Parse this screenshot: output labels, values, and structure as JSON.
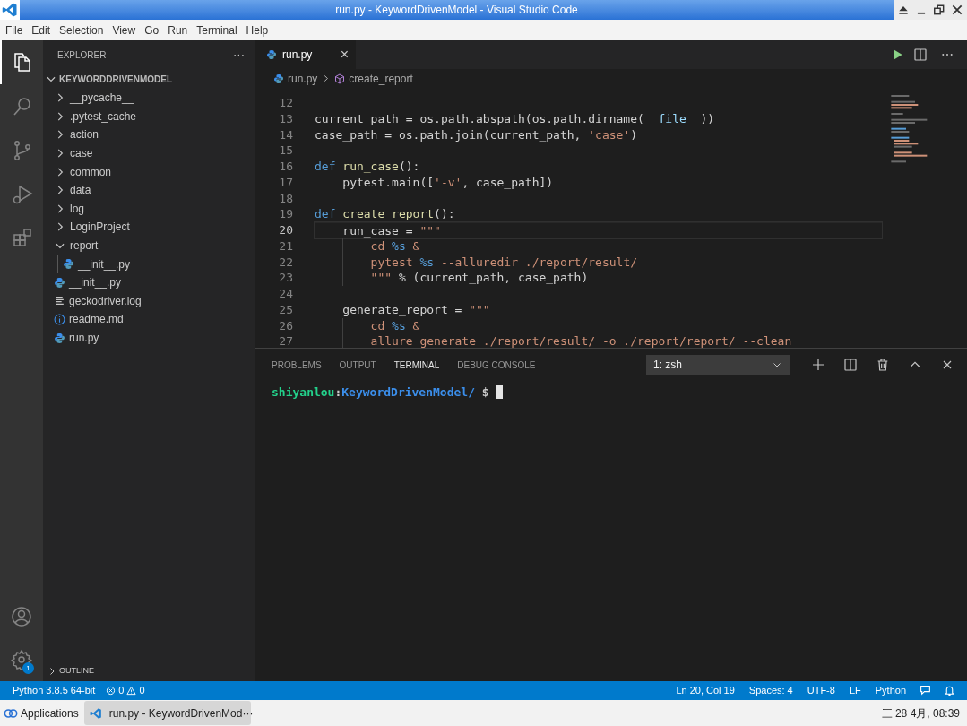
{
  "window": {
    "title": "run.py - KeywordDrivenModel - Visual Studio Code"
  },
  "menu": [
    "File",
    "Edit",
    "Selection",
    "View",
    "Go",
    "Run",
    "Terminal",
    "Help"
  ],
  "activity_bar": [
    {
      "kind": "files",
      "selected": true
    },
    {
      "kind": "search",
      "selected": false
    },
    {
      "kind": "scm",
      "selected": false
    },
    {
      "kind": "debug",
      "selected": false
    },
    {
      "kind": "extensions",
      "selected": false
    }
  ],
  "activity_bottom": [
    {
      "kind": "account"
    },
    {
      "kind": "settings",
      "badge": "1"
    }
  ],
  "sidebar": {
    "title": "EXPLORER",
    "more": "···",
    "root": {
      "label": "KEYWORDDRIVENMODEL",
      "expanded": true
    },
    "items": [
      {
        "kind": "folder",
        "label": "__pycache__",
        "expanded": false
      },
      {
        "kind": "folder",
        "label": ".pytest_cache",
        "expanded": false
      },
      {
        "kind": "folder",
        "label": "action",
        "expanded": false
      },
      {
        "kind": "folder",
        "label": "case",
        "expanded": false
      },
      {
        "kind": "folder",
        "label": "common",
        "expanded": false
      },
      {
        "kind": "folder",
        "label": "data",
        "expanded": false
      },
      {
        "kind": "folder",
        "label": "log",
        "expanded": false
      },
      {
        "kind": "folder",
        "label": "LoginProject",
        "expanded": false
      },
      {
        "kind": "folder",
        "label": "report",
        "expanded": true,
        "children": [
          {
            "kind": "python",
            "label": "__init__.py"
          }
        ]
      },
      {
        "kind": "python",
        "label": "__init__.py"
      },
      {
        "kind": "log",
        "label": "geckodriver.log"
      },
      {
        "kind": "info",
        "label": "readme.md"
      },
      {
        "kind": "python",
        "label": "run.py"
      }
    ],
    "outline": {
      "label": "OUTLINE",
      "expanded": false
    }
  },
  "tabs": [
    {
      "label": "run.py",
      "selected": true,
      "close": "×"
    }
  ],
  "breadcrumb": [
    {
      "kind": "python",
      "label": "run.py"
    },
    {
      "kind": "method",
      "label": "create_report"
    }
  ],
  "code": [
    {
      "number": "12",
      "current": false
    },
    {
      "number": "13",
      "current": false,
      "tokens": [
        {
          "kind": "plain",
          "text": "current_path = os.path.abspath(os.path.dirname("
        },
        {
          "kind": "variable",
          "text": "__file__"
        },
        {
          "kind": "plain",
          "text": "))"
        }
      ]
    },
    {
      "number": "14",
      "current": false,
      "tokens": [
        {
          "kind": "plain",
          "text": "case_path = os.path.join(current_path, "
        },
        {
          "kind": "string",
          "text": "'case'"
        },
        {
          "kind": "plain",
          "text": ")"
        }
      ]
    },
    {
      "number": "15",
      "current": false
    },
    {
      "number": "16",
      "current": false,
      "tokens": [
        {
          "kind": "keyword",
          "text": "def "
        },
        {
          "kind": "function",
          "text": "run_case"
        },
        {
          "kind": "plain",
          "text": "():"
        }
      ]
    },
    {
      "number": "17",
      "current": false,
      "tokens": [
        {
          "kind": "plain",
          "text": "    pytest.main(["
        },
        {
          "kind": "string",
          "text": "'-v'"
        },
        {
          "kind": "plain",
          "text": ", case_path])"
        }
      ]
    },
    {
      "number": "18",
      "current": false
    },
    {
      "number": "19",
      "current": false,
      "tokens": [
        {
          "kind": "keyword",
          "text": "def "
        },
        {
          "kind": "function",
          "text": "create_report"
        },
        {
          "kind": "plain",
          "text": "():"
        }
      ]
    },
    {
      "number": "20",
      "current": true,
      "tokens": [
        {
          "kind": "plain",
          "text": "    run_case = "
        },
        {
          "kind": "string",
          "text": "\"\"\""
        }
      ]
    },
    {
      "number": "21",
      "current": false,
      "tokens": [
        {
          "kind": "string",
          "text": "        cd "
        },
        {
          "kind": "format",
          "text": "%s"
        },
        {
          "kind": "string",
          "text": " &"
        }
      ]
    },
    {
      "number": "22",
      "current": false,
      "tokens": [
        {
          "kind": "string",
          "text": "        pytest "
        },
        {
          "kind": "format",
          "text": "%s"
        },
        {
          "kind": "string",
          "text": " --alluredir ./report/result/"
        }
      ]
    },
    {
      "number": "23",
      "current": false,
      "tokens": [
        {
          "kind": "string",
          "text": "        \"\"\""
        },
        {
          "kind": "plain",
          "text": " % (current_path, case_path)"
        }
      ]
    },
    {
      "number": "24",
      "current": false
    },
    {
      "number": "25",
      "current": false,
      "tokens": [
        {
          "kind": "plain",
          "text": "    generate_report = "
        },
        {
          "kind": "string",
          "text": "\"\"\""
        }
      ]
    },
    {
      "number": "26",
      "current": false,
      "tokens": [
        {
          "kind": "string",
          "text": "        cd "
        },
        {
          "kind": "format",
          "text": "%s"
        },
        {
          "kind": "string",
          "text": " &"
        }
      ]
    },
    {
      "number": "27",
      "current": false,
      "tokens": [
        {
          "kind": "string",
          "text": "        allure generate ./report/result/ -o ./report/report/ --clean"
        }
      ]
    }
  ],
  "panel": {
    "tabs": [
      {
        "label": "PROBLEMS",
        "selected": false
      },
      {
        "label": "OUTPUT",
        "selected": false
      },
      {
        "label": "TERMINAL",
        "selected": true
      },
      {
        "label": "DEBUG CONSOLE",
        "selected": false
      }
    ],
    "terminal_select": "1: zsh",
    "prompt": {
      "user": "shiyanlou",
      "separator": ":",
      "path": "KeywordDrivenModel/",
      "symbol": "$"
    }
  },
  "status_bar": {
    "left": [
      {
        "kind": "text",
        "text": "Python 3.8.5 64-bit"
      },
      {
        "kind": "problems",
        "errors": "0",
        "warnings": "0"
      }
    ],
    "right": [
      {
        "kind": "text",
        "text": "Ln 20, Col 19"
      },
      {
        "kind": "text",
        "text": "Spaces: 4"
      },
      {
        "kind": "text",
        "text": "UTF-8"
      },
      {
        "kind": "text",
        "text": "LF"
      },
      {
        "kind": "text",
        "text": "Python"
      },
      {
        "kind": "feedback"
      },
      {
        "kind": "bell"
      }
    ]
  },
  "taskbar": {
    "applications": "Applications",
    "window": "run.py - KeywordDrivenMod···",
    "clock": "三 28 4月, 08:39"
  }
}
